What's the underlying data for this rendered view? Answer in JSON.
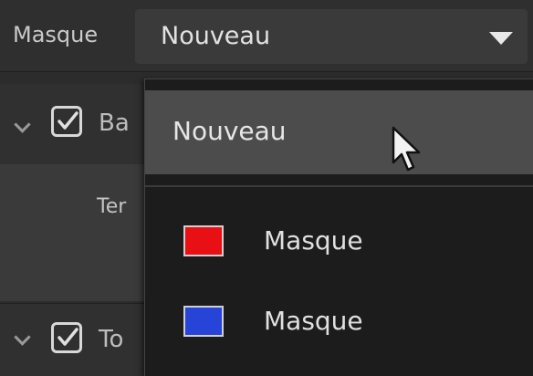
{
  "property": {
    "label": "Masque",
    "selected": "Nouveau"
  },
  "background_rows": {
    "row1_label_partial": "Ba",
    "row2_label_partial": "Ter",
    "row3_label_partial": "To"
  },
  "dropdown": {
    "items": [
      {
        "label": "Nouveau",
        "state": "hovered"
      },
      {
        "label": "Masque",
        "swatch_color": "#e81014"
      },
      {
        "label": "Masque",
        "swatch_color": "#2644d8"
      }
    ]
  }
}
